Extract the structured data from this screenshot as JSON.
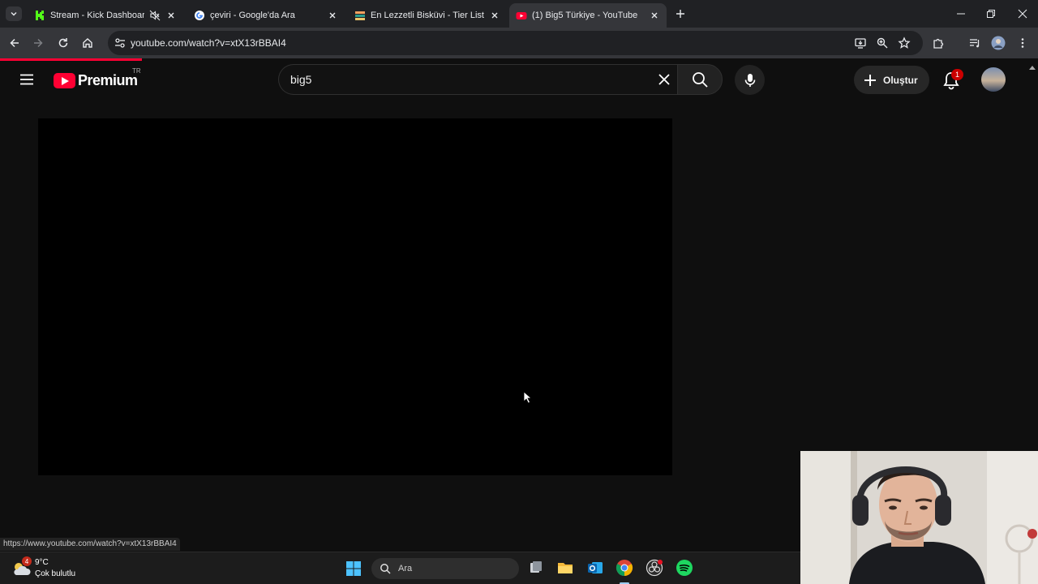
{
  "browser": {
    "tabs": [
      {
        "title": "Stream - Kick Dashboard",
        "icon": "kick-icon",
        "muted": true,
        "active": false
      },
      {
        "title": "çeviri - Google'da Ara",
        "icon": "google-icon",
        "muted": false,
        "active": false
      },
      {
        "title": "En Lezzetli Bisküvi - Tier List, Ko",
        "icon": "tierlist-icon",
        "muted": false,
        "active": false
      },
      {
        "title": "(1) Big5 Türkiye - YouTube",
        "icon": "youtube-icon",
        "muted": false,
        "active": true
      }
    ],
    "url": "youtube.com/watch?v=xtX13rBBAI4",
    "status_url": "https://www.youtube.com/watch?v=xtX13rBBAI4"
  },
  "youtube": {
    "logo_text": "Premium",
    "country_code": "TR",
    "search_query": "big5",
    "create_label": "Oluştur",
    "notification_count": "1"
  },
  "taskbar": {
    "temperature": "9°C",
    "condition": "Çok bulutlu",
    "weather_badge": "4",
    "search_placeholder": "Ara"
  },
  "colors": {
    "youtube_red": "#ff0033",
    "page_bg": "#0f0f0f",
    "chrome_toolbar": "#35363a"
  }
}
